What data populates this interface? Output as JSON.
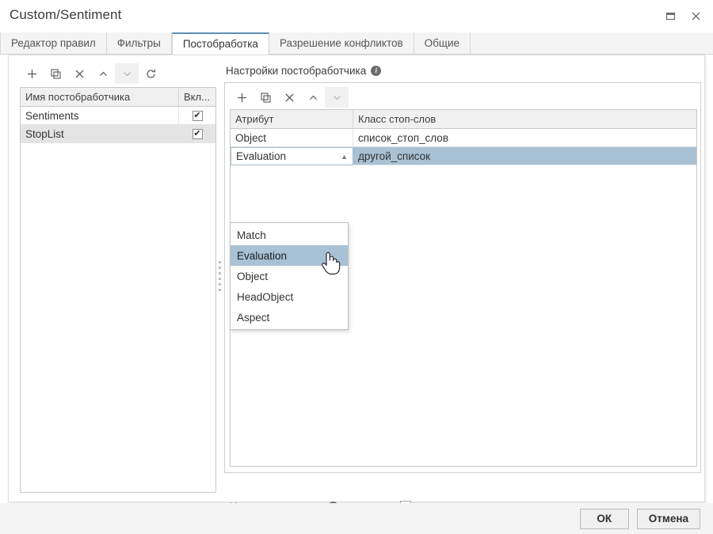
{
  "window": {
    "title": "Custom/Sentiment",
    "controls": [
      {
        "name": "restore-icon",
        "glyph": "❐"
      },
      {
        "name": "close-icon",
        "glyph": "✕"
      }
    ]
  },
  "tabs": [
    {
      "label": "Редактор правил",
      "active": false
    },
    {
      "label": "Фильтры",
      "active": false
    },
    {
      "label": "Постобработка",
      "active": true
    },
    {
      "label": "Разрешение конфликтов",
      "active": false
    },
    {
      "label": "Общие",
      "active": false
    }
  ],
  "left_panel": {
    "toolbar": [
      {
        "name": "add-button",
        "glyph": "+",
        "state": "enabled"
      },
      {
        "name": "duplicate-button",
        "glyph": "⧉",
        "state": "enabled"
      },
      {
        "name": "delete-button",
        "glyph": "✕",
        "state": "enabled"
      },
      {
        "name": "move-up-button",
        "glyph": "⌃",
        "state": "enabled"
      },
      {
        "name": "move-down-button",
        "glyph": "⌄",
        "state": "disabled"
      },
      {
        "name": "refresh-button",
        "glyph": "⟳",
        "state": "enabled"
      }
    ],
    "columns": [
      "Имя постобработчика",
      "Вкл..."
    ],
    "rows": [
      {
        "name": "Sentiments",
        "enabled": true,
        "selected": false
      },
      {
        "name": "StopList",
        "enabled": true,
        "selected": true
      }
    ],
    "checkmark": "✔"
  },
  "right_panel": {
    "title": "Настройки постобработчика",
    "info_glyph": "i",
    "toolbar": [
      {
        "name": "add-button",
        "glyph": "+",
        "state": "enabled"
      },
      {
        "name": "duplicate-button",
        "glyph": "⧉",
        "state": "enabled"
      },
      {
        "name": "delete-button",
        "glyph": "✕",
        "state": "enabled"
      },
      {
        "name": "move-up-button",
        "glyph": "⌃",
        "state": "enabled"
      },
      {
        "name": "move-down-button",
        "glyph": "⌄",
        "state": "disabled"
      }
    ],
    "columns": [
      "Атрибут",
      "Класс стоп-слов"
    ],
    "rows": [
      {
        "attribute": "Object",
        "stopword_class": "список_стоп_слов",
        "selected": false,
        "editing": false
      },
      {
        "attribute": "Evaluation",
        "stopword_class": "другой_список",
        "selected": true,
        "editing": true
      }
    ],
    "dropdown": {
      "open": true,
      "caret_glyph": "▲",
      "options": [
        "Match",
        "Evaluation",
        "Object",
        "HeadObject",
        "Aspect"
      ],
      "selected": "Evaluation"
    },
    "option": {
      "label": "Учитывать регистр",
      "info_glyph": "i",
      "checked": false
    }
  },
  "footer": {
    "ok_label": "ОК",
    "cancel_label": "Отмена"
  },
  "colors": {
    "accent_tab": "#5b8db8",
    "selection_blue": "#a8c1d4",
    "selection_gray": "#e4e4e4",
    "panel_bg": "#f4f4f4"
  }
}
